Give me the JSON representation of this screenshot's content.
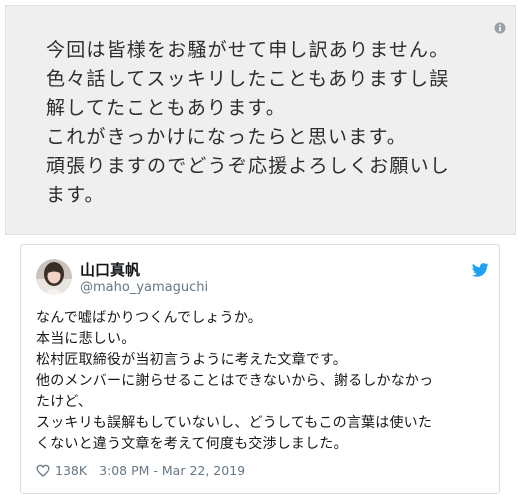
{
  "statement": {
    "lines": [
      "今回は皆様をお騒がせて申し訳ありません。",
      "色々話してスッキリしたこともありますし誤",
      "解してたこともあります。",
      "これがきっかけになったらと思います。",
      "頑張りますのでどうぞ応援よろしくお願いし",
      "ます。"
    ]
  },
  "tweet": {
    "display_name": "山口真帆",
    "handle": "@maho_yamaguchi",
    "body": [
      "なんで嘘ばかりつくんでしょうか。",
      "本当に悲しい。",
      "松村匠取締役が当初言うように考えた文章です。",
      "他のメンバーに謝らせることはできないから、謝るしかなかっ",
      "たけど、",
      "スッキリも誤解もしていないし、どうしてもこの言葉は使いた",
      "くないと違う文章を考えて何度も交渉しました。"
    ],
    "likes": "138K",
    "timestamp": "3:08 PM - Mar 22, 2019"
  },
  "icons": {
    "info": "info-icon",
    "twitter": "twitter-bird-icon",
    "like": "heart-icon",
    "twitter_color": "#1da1f2"
  }
}
